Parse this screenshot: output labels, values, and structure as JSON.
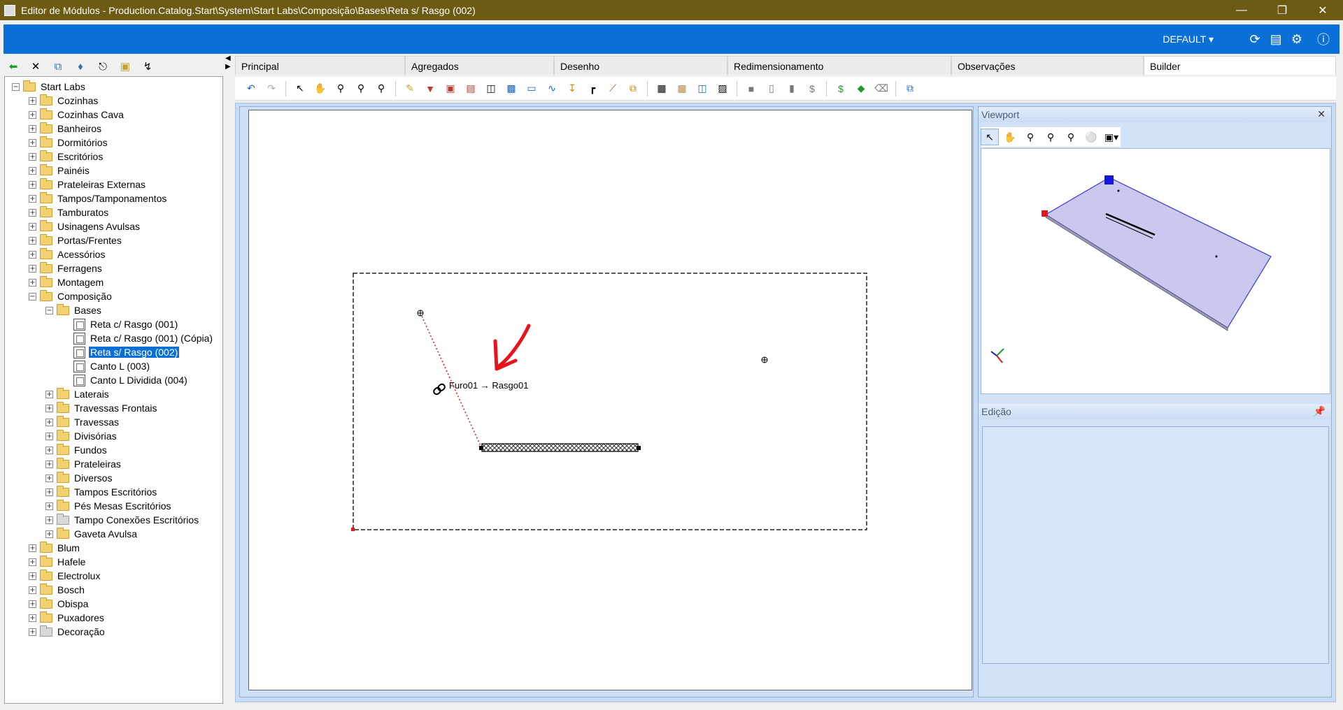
{
  "window": {
    "title": "Editor de Módulos - Production.Catalog.Start\\System\\Start Labs\\Composição\\Bases\\Reta s/ Rasgo (002)",
    "minimize_icon": "minimize-icon",
    "restore_icon": "restore-icon",
    "close_icon": "close-icon"
  },
  "topbar": {
    "profile": "DEFAULT",
    "accent": "#0a6fd6"
  },
  "tree": {
    "root": "Start Labs",
    "items": [
      "Cozinhas",
      "Cozinhas Cava",
      "Banheiros",
      "Dormitórios",
      "Escritórios",
      "Painéis",
      "Prateleiras Externas",
      "Tampos/Tamponamentos",
      "Tamburatos",
      "Usinagens Avulsas",
      "Portas/Frentes",
      "Acessórios",
      "Ferragens",
      "Montagem",
      "Composição"
    ],
    "composicao_children": {
      "bases": "Bases",
      "bases_children": [
        "Reta c/ Rasgo (001)",
        "Reta c/ Rasgo (001) (Cópia)",
        "Reta s/ Rasgo (002)",
        "Canto L (003)",
        "Canto L Dividida (004)"
      ],
      "others": [
        "Laterais",
        "Travessas Frontais",
        "Travessas",
        "Divisórias",
        "Fundos",
        "Prateleiras",
        "Diversos",
        "Tampos Escritórios",
        "Pés Mesas Escritórios",
        "Tampo Conexões Escritórios",
        "Gaveta Avulsa"
      ]
    },
    "bottom_items": [
      "Blum",
      "Hafele",
      "Electrolux",
      "Bosch",
      "Obispa",
      "Puxadores",
      "Decoração"
    ]
  },
  "tabs": [
    "Principal",
    "Agregados",
    "Desenho",
    "Redimensionamento",
    "Observações",
    "Builder"
  ],
  "active_tab": "Builder",
  "canvas": {
    "link_label": "Furo01 → Rasgo01",
    "arrow_color": "#e8141c"
  },
  "panels": {
    "viewport_title": "Viewport",
    "edicao_title": "Edição"
  }
}
